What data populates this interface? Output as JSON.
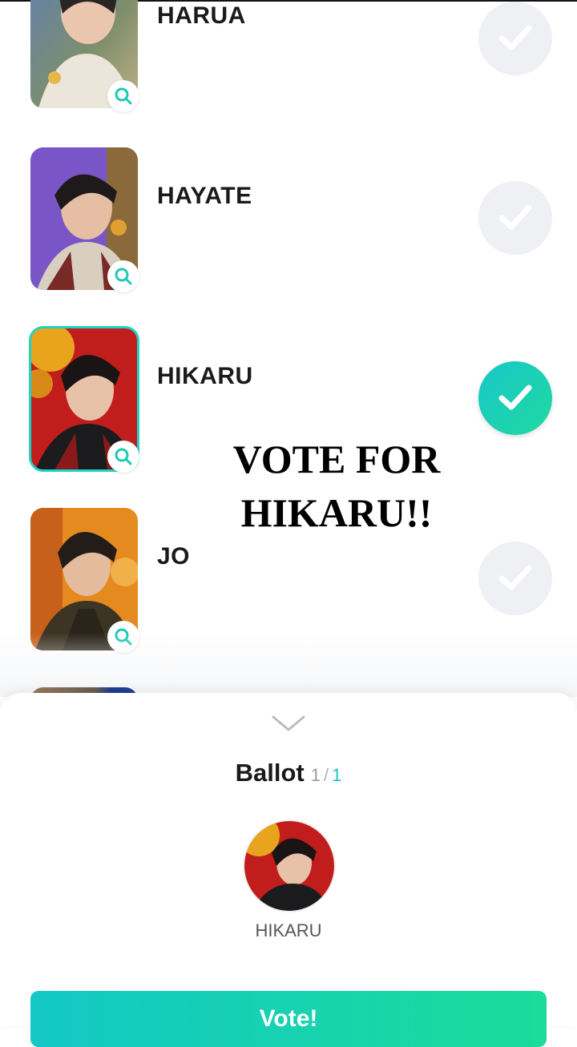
{
  "candidates": [
    {
      "name": "HARUA",
      "selected": false,
      "zoom_icon": "search-icon",
      "check_icon": "check-icon"
    },
    {
      "name": "HAYATE",
      "selected": false,
      "zoom_icon": "search-icon",
      "check_icon": "check-icon"
    },
    {
      "name": "HIKARU",
      "selected": true,
      "zoom_icon": "search-icon",
      "check_icon": "check-icon"
    },
    {
      "name": "JO",
      "selected": false,
      "zoom_icon": "search-icon",
      "check_icon": "check-icon"
    }
  ],
  "overlay": {
    "line1": "VOTE FOR",
    "line2": "HIKARU!!"
  },
  "ballot": {
    "title": "Ballot",
    "current": "1",
    "separator": "/",
    "total": "1",
    "selected_name": "HIKARU",
    "collapse_icon": "chevron-down-icon"
  },
  "vote_button": {
    "label": "Vote!"
  },
  "colors": {
    "accent": "#18c7c9",
    "accent_end": "#1fd9a0",
    "check_off": "#eef0f3"
  }
}
